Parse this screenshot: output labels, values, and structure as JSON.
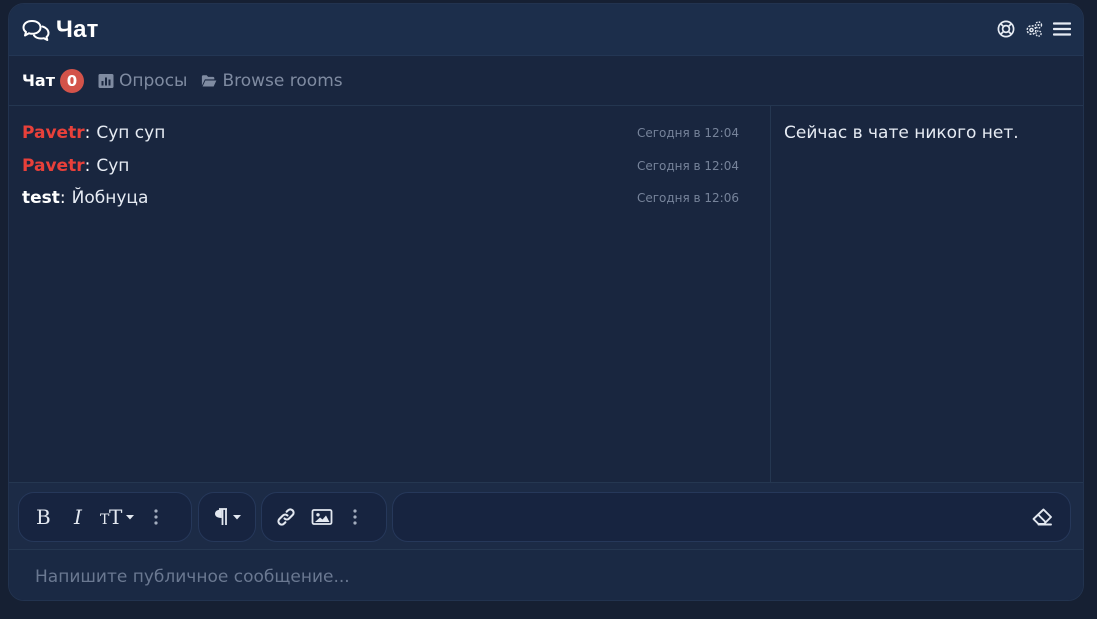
{
  "header": {
    "title": "Чат",
    "icons": [
      "chat-bubbles-icon",
      "lifebuoy-icon",
      "gears-icon",
      "menu-icon"
    ]
  },
  "tabs": [
    {
      "label": "Чат",
      "badge": "0",
      "active": true
    },
    {
      "label": "Опросы",
      "icon": "bar-chart-icon"
    },
    {
      "label": "Browse rooms",
      "icon": "folder-open-icon"
    }
  ],
  "messages": [
    {
      "author": "Pavetr",
      "text": "Суп суп",
      "time": "Сегодня в 12:04",
      "author_color": "#e8403a"
    },
    {
      "author": "Pavetr",
      "text": "Суп",
      "time": "Сегодня в 12:04",
      "author_color": "#e8403a"
    },
    {
      "author": "test",
      "text": "Йобнуца",
      "time": "Сегодня в 12:06",
      "author_color": "#ffffff"
    }
  ],
  "online": {
    "empty_text": "Сейчас в чате никого нет."
  },
  "toolbar": {
    "icons": [
      "bold-icon",
      "italic-icon",
      "text-size-icon",
      "more-icon",
      "paragraph-icon",
      "link-icon",
      "image-icon",
      "more-icon",
      "eraser-icon"
    ]
  },
  "composer": {
    "placeholder": "Напишите публичное сообщение..."
  },
  "colors": {
    "background": "#162033",
    "panel": "#19263f",
    "header": "#1c2e4b",
    "badge": "#d3534a",
    "accent_red": "#e8403a"
  }
}
